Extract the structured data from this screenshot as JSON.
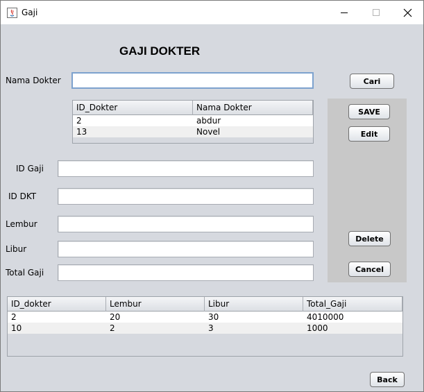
{
  "window": {
    "title": "Gaji",
    "icon": "java-app-icon"
  },
  "heading": "GAJI DOKTER",
  "search": {
    "label": "Nama Dokter",
    "value": "",
    "button": "Cari"
  },
  "doctor_table": {
    "columns": [
      "ID_Dokter",
      "Nama Dokter"
    ],
    "rows": [
      [
        "2",
        "abdur"
      ],
      [
        "13",
        "Novel"
      ]
    ]
  },
  "form": {
    "id_gaji": {
      "label": "ID Gaji",
      "value": ""
    },
    "id_dkt": {
      "label": "ID DKT",
      "value": ""
    },
    "lembur": {
      "label": "Lembur",
      "value": ""
    },
    "libur": {
      "label": "Libur",
      "value": ""
    },
    "total_gaji": {
      "label": "Total Gaji",
      "value": ""
    }
  },
  "actions": {
    "save": "SAVE",
    "edit": "Edit",
    "delete": "Delete",
    "cancel": "Cancel",
    "back": "Back"
  },
  "salary_table": {
    "columns": [
      "ID_dokter",
      "Lembur",
      "Libur",
      "Total_Gaji"
    ],
    "rows": [
      [
        "2",
        "20",
        "30",
        "4010000"
      ],
      [
        "10",
        "2",
        "3",
        "1000"
      ]
    ]
  }
}
